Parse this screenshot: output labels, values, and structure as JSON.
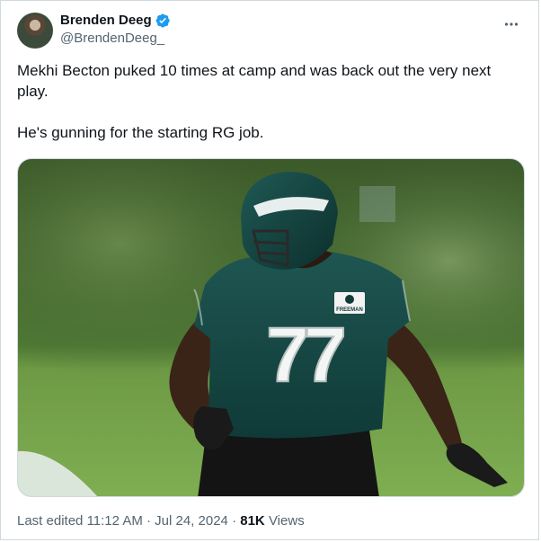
{
  "author": {
    "display_name": "Brenden Deeg",
    "handle": "@BrendenDeeg_",
    "verified": true
  },
  "tweet": {
    "paragraphs": [
      "Mekhi Becton puked 10 times at camp and was back out the very next play.",
      "He's gunning for the starting RG job."
    ],
    "media": {
      "jersey_number": "77",
      "patch_text": "FREEMAN"
    }
  },
  "meta": {
    "edited_label": "Last edited",
    "time": "11:12 AM",
    "separator": "·",
    "date": "Jul 24, 2024",
    "views_count": "81K",
    "views_label": "Views"
  },
  "icons": {
    "verified": "verified-badge-icon",
    "more": "more-options-icon"
  },
  "colors": {
    "verified_blue": "#1d9bf0",
    "secondary_text": "#536471",
    "primary_text": "#0f1419"
  }
}
